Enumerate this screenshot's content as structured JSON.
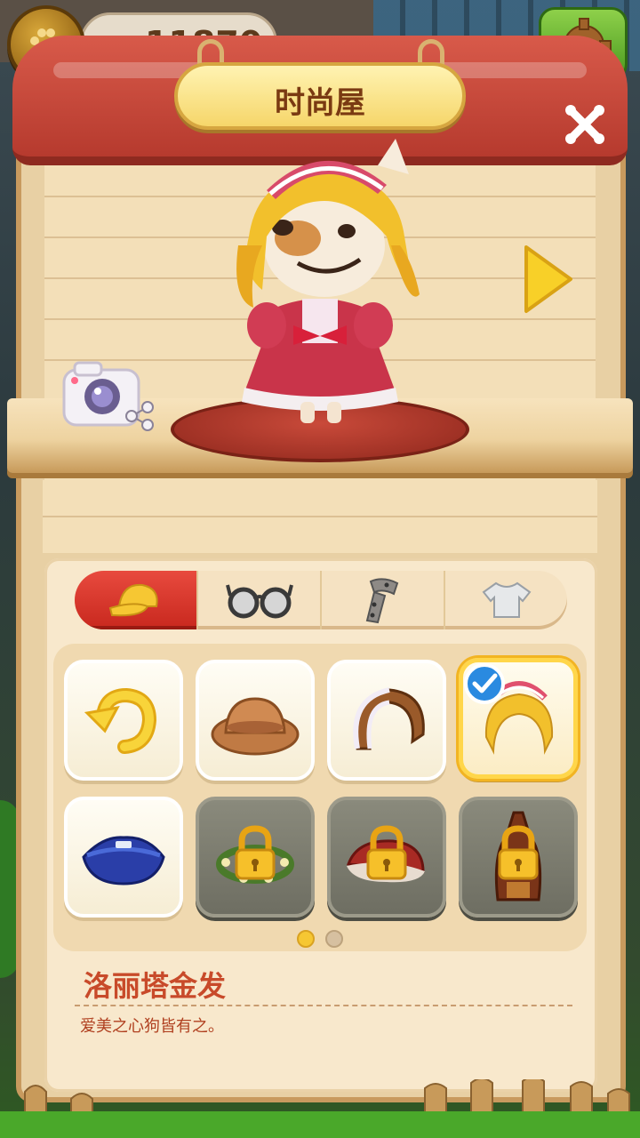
{
  "hud": {
    "coins": "11870"
  },
  "window": {
    "title": "时尚屋"
  },
  "categories": [
    {
      "name": "hat",
      "icon": "hat-icon",
      "active": true
    },
    {
      "name": "glasses",
      "icon": "glasses-icon",
      "active": false
    },
    {
      "name": "scarf",
      "icon": "scarf-icon",
      "active": false
    },
    {
      "name": "shirt",
      "icon": "shirt-icon",
      "active": false
    }
  ],
  "items": [
    {
      "icon": "undo-arrow-icon",
      "state": "unlocked"
    },
    {
      "icon": "brown-bowler-hat-icon",
      "state": "unlocked"
    },
    {
      "icon": "brown-headband-icon",
      "state": "unlocked"
    },
    {
      "icon": "lolita-blonde-wig-icon",
      "state": "selected"
    },
    {
      "icon": "blue-cap-icon",
      "state": "unlocked"
    },
    {
      "icon": "flower-wreath-icon",
      "state": "locked"
    },
    {
      "icon": "red-santa-hat-icon",
      "state": "locked"
    },
    {
      "icon": "brown-hood-icon",
      "state": "locked"
    }
  ],
  "pager": {
    "pages": 2,
    "current": 1
  },
  "selected_item": {
    "name": "洛丽塔金发",
    "description": "爱美之心狗皆有之。"
  },
  "colors": {
    "accent_red": "#d8372c",
    "selected_gold": "#ffd64a",
    "name_text": "#c84a2a"
  }
}
